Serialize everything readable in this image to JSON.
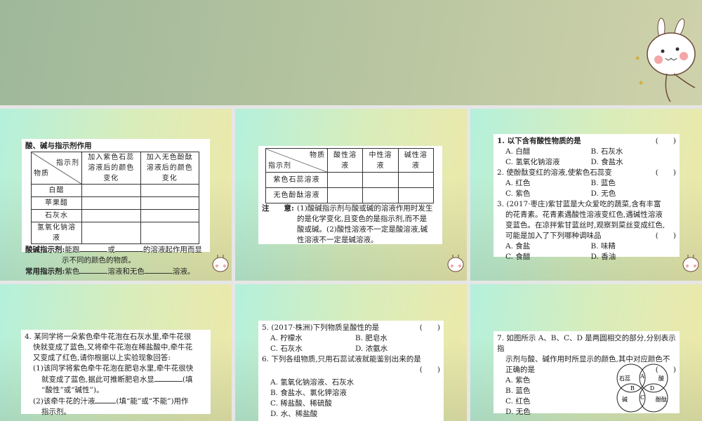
{
  "panel1": {
    "title": "酸、碱与指示剂作用",
    "diag_top": "指示剂",
    "diag_bottom": "物质",
    "col1": "加入紫色石蕊溶液后的颜色变化",
    "col2": "加入无色酚酞溶液后的颜色变化",
    "rows": [
      "白醋",
      "苹果醋",
      "石灰水",
      "氢氧化钠溶液"
    ],
    "def_label": "酸碱指示剂:",
    "def_a": "能跟",
    "def_b": "或",
    "def_c": "的溶液起作用而显",
    "def_d": "示不同的颜色的物质。",
    "common_label": "常用指示剂:",
    "common_a": "紫色",
    "common_b": "溶液和无色",
    "common_c": "溶液。"
  },
  "panel2": {
    "diag_top": "物质",
    "diag_bottom": "指示剂",
    "cols": [
      "酸性溶液",
      "中性溶液",
      "碱性溶液"
    ],
    "rows": [
      "紫色石蕊溶液",
      "无色酚酞溶液"
    ],
    "note_label": "注　　意:",
    "note_lines": [
      "(1)酸碱指示剂与酸或碱的溶液作用时发生",
      "的是化学变化,且变色的是指示剂,而不是",
      "酸或碱。(2)酸性溶液不一定是酸溶液,碱",
      "性溶液不一定是碱溶液。"
    ]
  },
  "panel3": {
    "q1": "1. 以下含有酸性物质的是",
    "q1_opts": [
      "A. 白醋",
      "B. 石灰水",
      "C. 氢氧化钠溶液",
      "D. 食盐水"
    ],
    "q2": "2. 使酚酞变红的溶液,使紫色石蕊变",
    "q2_opts": [
      "A. 红色",
      "B. 蓝色",
      "C. 紫色",
      "D. 无色"
    ],
    "q3_lines": [
      "3. (2017·枣庄)紫甘蓝是大众爱吃的蔬菜,含有丰富",
      "的花青素。花青素遇酸性溶液变红色,遇碱性溶液",
      "变蓝色。在凉拌紫甘蓝丝时,观察到菜丝变成红色,",
      "可能是加入了下列哪种调味品"
    ],
    "q3_opts": [
      "A. 食盐",
      "B. 味精",
      "C. 食醋",
      "D. 香油"
    ],
    "paren": "(　　)"
  },
  "panel4": {
    "lines": [
      "4. 某同学将一朵紫色牵牛花泡在石灰水里,牵牛花很",
      "快就变成了蓝色,又将牵牛花泡在稀盐酸中,牵牛花",
      "又变成了红色,请你根据以上实验现象回答:"
    ],
    "s1a": "(1)该同学将紫色牵牛花泡在肥皂水里,牵牛花很快",
    "s1b": "就变成了蓝色,据此可推断肥皂水显",
    "s1c": "(填",
    "s1d": "“酸性”或“碱性”)。",
    "s2a": "(2)该牵牛花的汁液",
    "s2b": "(填“能”或“不能”)用作",
    "s2c": "指示剂。"
  },
  "panel5": {
    "q5": "5. (2017·株洲)下列物质呈酸性的是",
    "q5_opts": [
      "A. 柠檬水",
      "B. 肥皂水",
      "C. 石灰水",
      "D. 浓氨水"
    ],
    "q6": "6. 下列各组物质,只用石蕊试液就能鉴别出来的是",
    "q6_opts": [
      "A. 氢氧化钠溶液、石灰水",
      "B. 食盐水、氯化钾溶液",
      "C. 稀盐酸、稀硫酸",
      "D. 水、稀盐酸"
    ],
    "paren": "(　　)"
  },
  "panel6": {
    "lines": [
      "7. 如图所示 A、B、C、D 是两圆相交的部分,分别表示指",
      "示剂与酸、碱作用时所显示的颜色,其中对应颜色不"
    ],
    "last": "正确的是",
    "paren": "(　　)",
    "opts": [
      "A. 紫色",
      "B. 蓝色",
      "C. 红色",
      "D. 无色"
    ],
    "venn": {
      "c1": "石蕊",
      "c2": "酸",
      "c3": "碱",
      "c4": "酚酞",
      "a": "A",
      "b": "B",
      "c": "C",
      "d": "D"
    }
  }
}
